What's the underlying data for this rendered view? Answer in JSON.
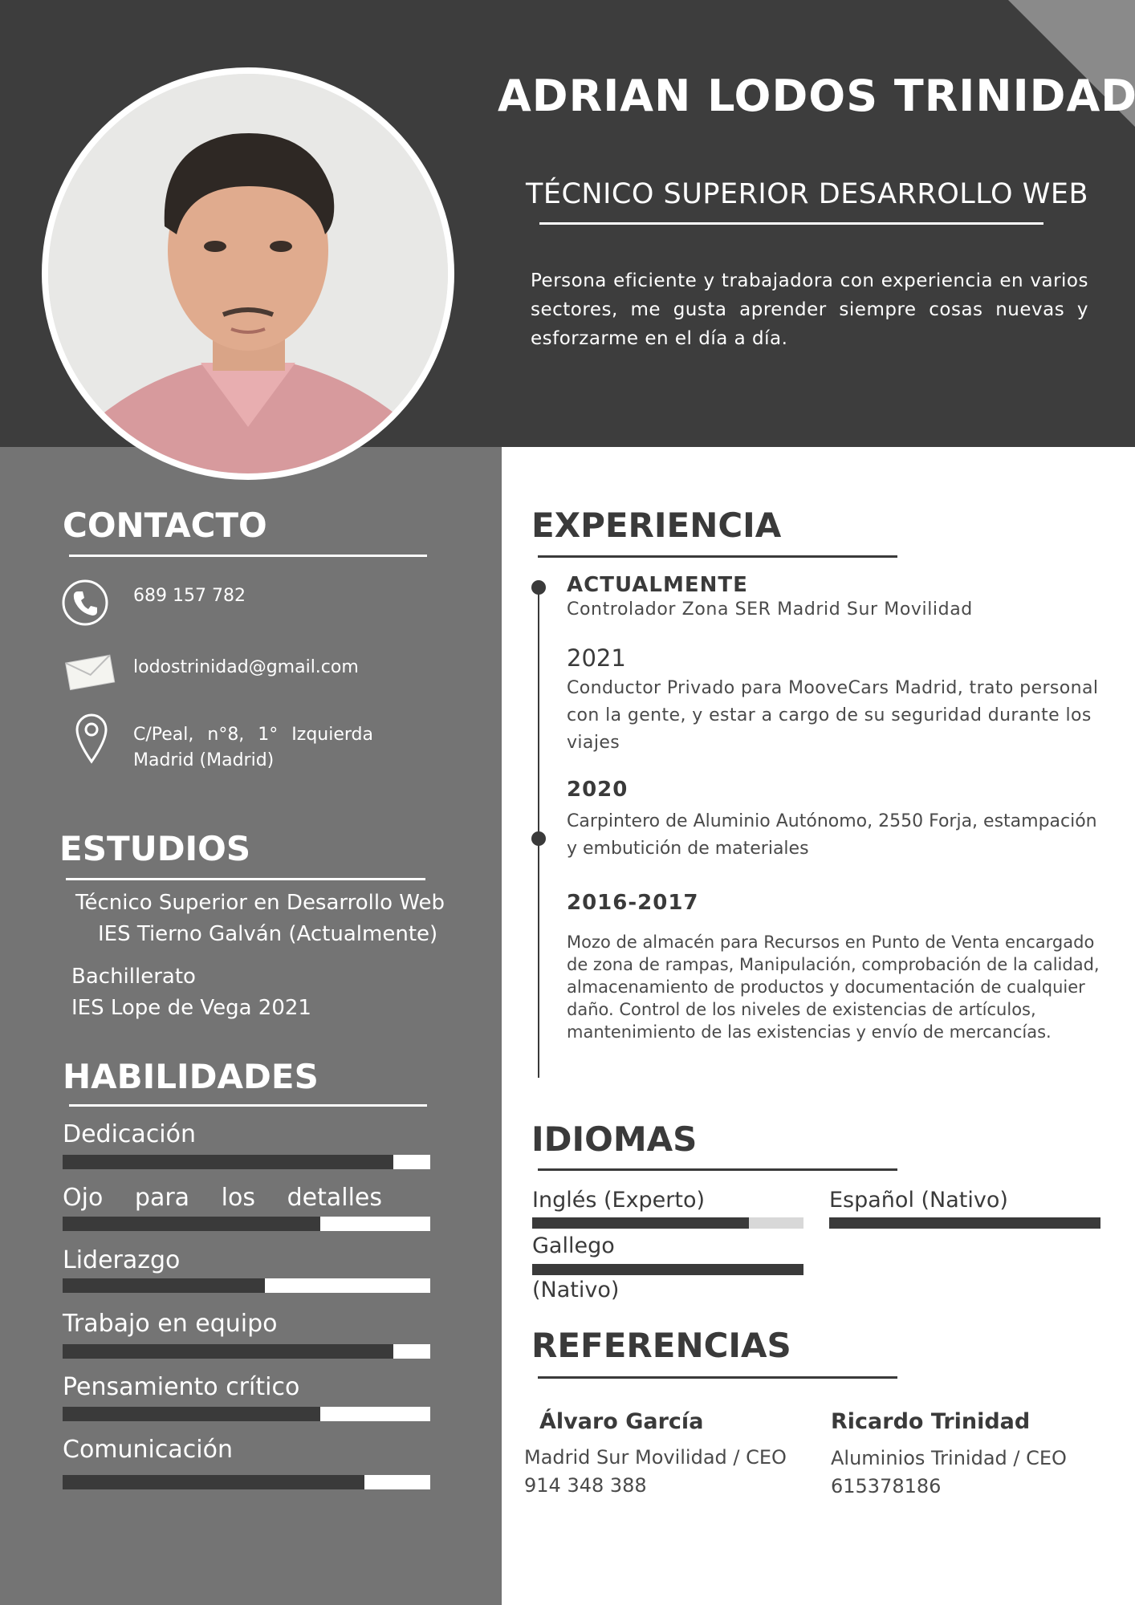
{
  "header": {
    "name": "ADRIAN LODOS TRINIDAD",
    "title": "TÉCNICO SUPERIOR DESARROLLO WEB",
    "summary": "Persona eficiente y trabajadora con experiencia en varios sectores, me gusta aprender siempre cosas nuevas y esforzarme en el día a día."
  },
  "contact": {
    "heading": "CONTACTO",
    "phone": "689 157 782",
    "email": "lodostrinidad@gmail.com",
    "address_line1": "C/Peal, n°8, 1° Izquierda",
    "address_line2": "Madrid (Madrid)",
    "icons": [
      "phone-icon",
      "envelope-icon",
      "location-pin-icon"
    ]
  },
  "education": {
    "heading": "ESTUDIOS",
    "items": [
      {
        "line1": "Técnico Superior en Desarrollo Web",
        "line2": "IES Tierno Galván (Actualmente)"
      },
      {
        "line1": "Bachillerato",
        "line2": "IES Lope de Vega 2021"
      }
    ]
  },
  "skills": {
    "heading": "HABILIDADES",
    "items": [
      {
        "label": "Dedicación",
        "level": 0.9
      },
      {
        "label": "Ojo para los detalles",
        "level": 0.7
      },
      {
        "label": "Liderazgo",
        "level": 0.55
      },
      {
        "label": "Trabajo en equipo",
        "level": 0.9
      },
      {
        "label": "Pensamiento crítico",
        "level": 0.7
      },
      {
        "label": "Comunicación",
        "level": 0.82
      }
    ]
  },
  "experience": {
    "heading": "EXPERIENCIA",
    "items": [
      {
        "date": "ACTUALMENTE",
        "text": "Controlador Zona SER Madrid Sur Movilidad"
      },
      {
        "date": "2021",
        "text": "Conductor Privado para MooveCars Madrid, trato personal con la gente, y estar a cargo de su seguridad durante los viajes"
      },
      {
        "date": "2020",
        "text": "Carpintero de Aluminio Autónomo, 2550 Forja, estampación y embutición de materiales"
      },
      {
        "date": "2016-2017",
        "text": "Mozo de almacén para Recursos en Punto de Venta encargado de zona de rampas, Manipulación, comprobación de la calidad, almacenamiento de productos y documentación de cualquier daño. Control de los niveles de existencias de artículos, mantenimiento de las existencias y envío de mercancías."
      }
    ]
  },
  "languages": {
    "heading": "IDIOMAS",
    "items": [
      {
        "label": "Inglés  (Experto)",
        "level": 0.8
      },
      {
        "label": "Español (Nativo)",
        "level": 1.0
      },
      {
        "label": "Gallego",
        "label2": "(Nativo)",
        "level": 1.0
      }
    ]
  },
  "references": {
    "heading": "REFERENCIAS",
    "items": [
      {
        "name": "Álvaro García",
        "company": "Madrid Sur Movilidad / CEO",
        "phone": "914 348 388"
      },
      {
        "name": "Ricardo Trinidad",
        "company": "Aluminios Trinidad / CEO",
        "phone": "615378186"
      }
    ]
  },
  "colors": {
    "header_bg": "#3d3d3d",
    "sidebar_bg": "#747474",
    "accent_dark": "#3a3a3a",
    "corner": "#8a8a8a"
  }
}
